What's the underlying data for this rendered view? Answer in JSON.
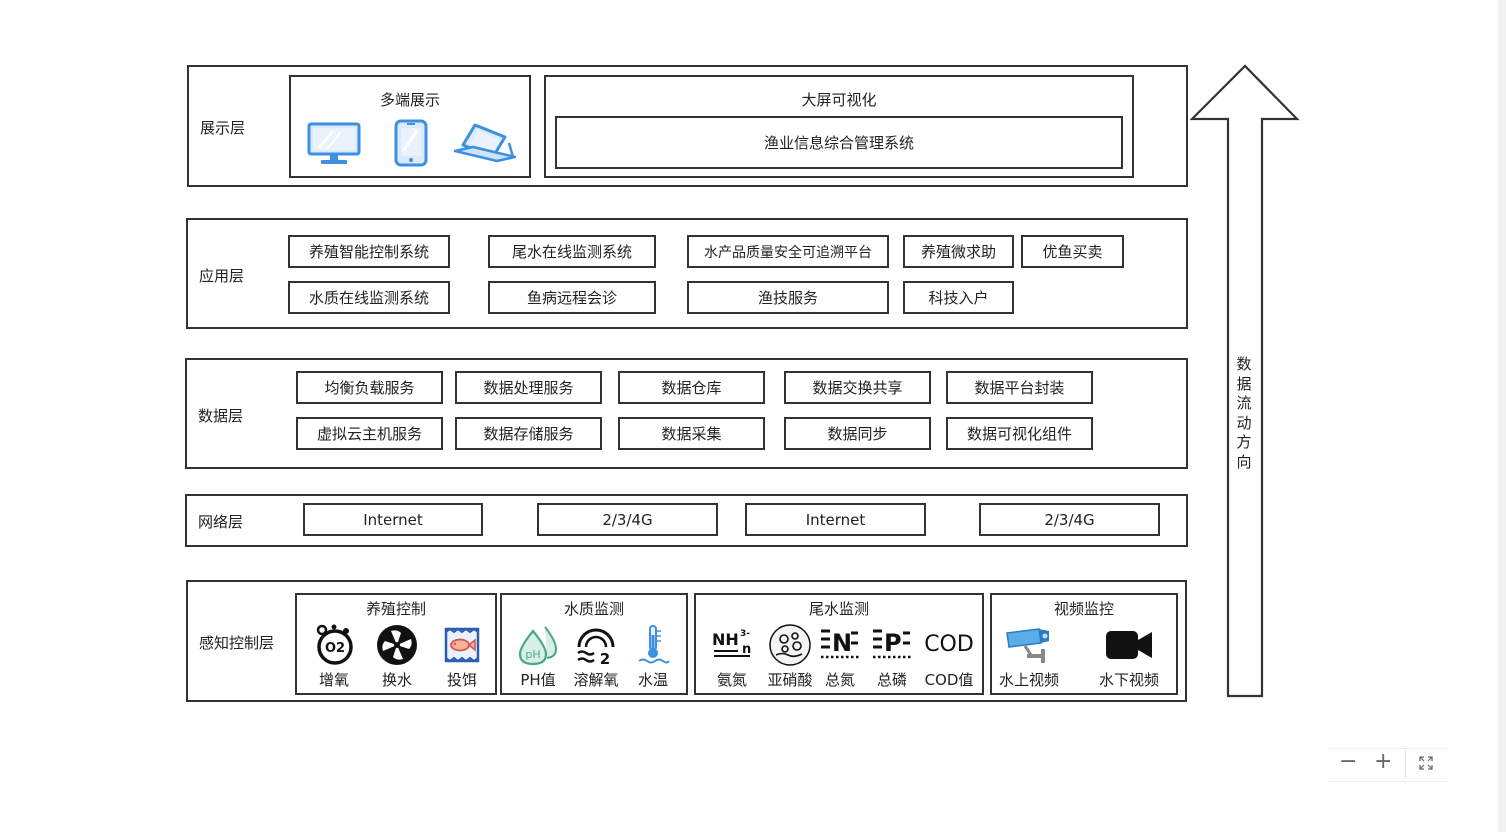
{
  "display_layer": {
    "label": "展示层",
    "multi_end": {
      "title": "多端展示",
      "devices": [
        "monitor-icon",
        "phone-icon",
        "tablet-icon"
      ]
    },
    "big_screen": {
      "title": "大屏可视化",
      "system": "渔业信息综合管理系统"
    }
  },
  "app_layer": {
    "label": "应用层",
    "row1": [
      "养殖智能控制系统",
      "尾水在线监测系统",
      "水产品质量安全可追溯平台",
      "养殖微求助",
      "优鱼买卖"
    ],
    "row2": [
      "水质在线监测系统",
      "鱼病远程会诊",
      "渔技服务",
      "科技入户"
    ]
  },
  "data_layer": {
    "label": "数据层",
    "row1": [
      "均衡负载服务",
      "数据处理服务",
      "数据仓库",
      "数据交换共享",
      "数据平台封装"
    ],
    "row2": [
      "虚拟云主机服务",
      "数据存储服务",
      "数据采集",
      "数据同步",
      "数据可视化组件"
    ]
  },
  "network_layer": {
    "label": "网络层",
    "items": [
      "Internet",
      "2/3/4G",
      "Internet",
      "2/3/4G"
    ]
  },
  "sensing_layer": {
    "label": "感知控制层",
    "groups": [
      {
        "title": "养殖控制",
        "items": [
          "增氧",
          "换水",
          "投饵"
        ]
      },
      {
        "title": "水质监测",
        "items": [
          "PH值",
          "溶解氧",
          "水温"
        ]
      },
      {
        "title": "尾水监测",
        "items": [
          "氨氮",
          "亚硝酸",
          "总氮",
          "总磷",
          "COD值"
        ]
      },
      {
        "title": "视频监控",
        "items": [
          "水上视频",
          "水下视频"
        ]
      }
    ],
    "icon_text": {
      "o2": "O2",
      "ph": "pH",
      "nh": "NH",
      "nh_sup": "3-",
      "nh_sub": "n",
      "n": "N",
      "p": "P",
      "cod": "COD"
    }
  },
  "flow_arrow": {
    "label": "数据流动方向",
    "chars": [
      "数",
      "据",
      "流",
      "动",
      "方",
      "向"
    ]
  },
  "zoom": {
    "minus": "−",
    "plus": "+"
  },
  "colors": {
    "border": "#333333",
    "icon_blue": "#3d8fe0",
    "icon_green": "#4aa88a",
    "icon_dark": "#111111"
  }
}
